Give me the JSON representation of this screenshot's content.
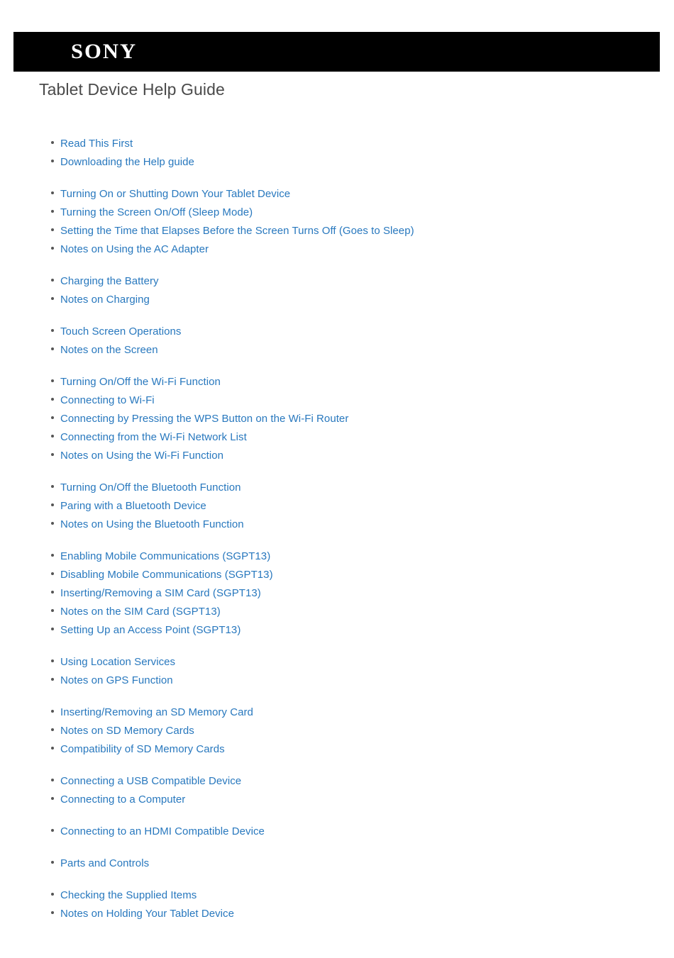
{
  "header": {
    "brand": "SONY",
    "bar_color": "#000000",
    "logo_color": "#ffffff"
  },
  "page_title": "Tablet Device Help Guide",
  "colors": {
    "link": "#2878be",
    "title": "#4a4a4a",
    "bullet": "#555555",
    "background": "#ffffff"
  },
  "toc": {
    "groups": [
      {
        "items": [
          {
            "label": "Read This First"
          },
          {
            "label": "Downloading the Help guide"
          }
        ]
      },
      {
        "items": [
          {
            "label": "Turning On or Shutting Down Your Tablet Device"
          },
          {
            "label": "Turning the Screen On/Off (Sleep Mode)"
          },
          {
            "label": "Setting the Time that Elapses Before the Screen Turns Off (Goes to Sleep)"
          },
          {
            "label": "Notes on Using the AC Adapter"
          }
        ]
      },
      {
        "items": [
          {
            "label": "Charging the Battery"
          },
          {
            "label": "Notes on Charging"
          }
        ]
      },
      {
        "items": [
          {
            "label": "Touch Screen Operations"
          },
          {
            "label": "Notes on the Screen"
          }
        ]
      },
      {
        "items": [
          {
            "label": "Turning On/Off the Wi-Fi Function"
          },
          {
            "label": "Connecting to Wi-Fi"
          },
          {
            "label": "Connecting by Pressing the WPS Button on the Wi-Fi Router"
          },
          {
            "label": "Connecting from the Wi-Fi Network List"
          },
          {
            "label": "Notes on Using the Wi-Fi Function"
          }
        ]
      },
      {
        "items": [
          {
            "label": "Turning On/Off the Bluetooth Function"
          },
          {
            "label": "Paring with a Bluetooth Device"
          },
          {
            "label": "Notes on Using the Bluetooth Function"
          }
        ]
      },
      {
        "items": [
          {
            "label": "Enabling Mobile Communications (SGPT13)"
          },
          {
            "label": "Disabling Mobile Communications (SGPT13)"
          },
          {
            "label": "Inserting/Removing a SIM Card (SGPT13)"
          },
          {
            "label": "Notes on the SIM Card (SGPT13)"
          },
          {
            "label": "Setting Up an Access Point (SGPT13)"
          }
        ]
      },
      {
        "items": [
          {
            "label": "Using Location Services"
          },
          {
            "label": "Notes on GPS Function"
          }
        ]
      },
      {
        "items": [
          {
            "label": "Inserting/Removing an SD Memory Card"
          },
          {
            "label": "Notes on SD Memory Cards"
          },
          {
            "label": "Compatibility of SD Memory Cards"
          }
        ]
      },
      {
        "items": [
          {
            "label": "Connecting a USB Compatible Device"
          },
          {
            "label": "Connecting to a Computer"
          }
        ]
      },
      {
        "items": [
          {
            "label": "Connecting to an HDMI Compatible Device"
          }
        ]
      },
      {
        "items": [
          {
            "label": "Parts and Controls"
          }
        ]
      },
      {
        "items": [
          {
            "label": "Checking the Supplied Items"
          },
          {
            "label": "Notes on Holding Your Tablet Device"
          }
        ]
      }
    ]
  }
}
